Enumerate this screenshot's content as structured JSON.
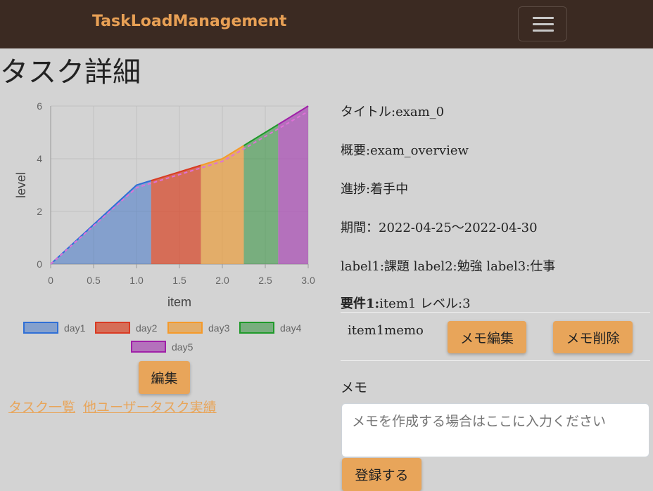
{
  "nav": {
    "brand": "TaskLoadManagement"
  },
  "page": {
    "title": "タスク詳細"
  },
  "task": {
    "title_line": "タイトル:exam_0",
    "overview_line": "概要:exam_overview",
    "progress_line": "進捗:着手中",
    "period_line": "期間：2022-04-25～2022-04-30",
    "labels_line": "label1:課題 label2:勉強 label3:仕事",
    "requirement_heading": "要件1:",
    "requirement_detail": "item1 レベル:3",
    "memo_text": "item1memo",
    "memo_edit_label": "メモ編集",
    "memo_delete_label": "メモ削除"
  },
  "memo": {
    "label": "メモ",
    "placeholder": "メモを作成する場合はここに入力ください",
    "submit_label": "登録する"
  },
  "actions": {
    "edit_label": "編集",
    "task_list_link": "タスク一覧",
    "other_users_link": "他ユーザータスク実績"
  },
  "chart_data": {
    "type": "area",
    "xlabel": "item",
    "ylabel": "level",
    "xlim": [
      0,
      3.0
    ],
    "ylim": [
      0,
      6
    ],
    "x_ticks": [
      "0",
      "0.5",
      "1.0",
      "1.5",
      "2.0",
      "2.5",
      "3.0"
    ],
    "y_ticks": [
      "0",
      "2",
      "4",
      "6"
    ],
    "grid": true,
    "legend_position": "bottom",
    "line": [
      [
        0,
        0
      ],
      [
        1.0,
        3.0
      ],
      [
        2.0,
        4.0
      ],
      [
        3.0,
        6.0
      ]
    ],
    "dashed_line": [
      [
        0,
        0
      ],
      [
        1.0,
        2.9
      ],
      [
        2.0,
        3.9
      ],
      [
        3.0,
        5.8
      ]
    ],
    "series": [
      {
        "name": "day1",
        "x_range": [
          0,
          1.17
        ],
        "fill": "rgba(54,110,200,0.5)",
        "stroke": "#2f6fd6"
      },
      {
        "name": "day2",
        "x_range": [
          1.17,
          1.75
        ],
        "fill": "rgba(215,75,45,0.75)",
        "stroke": "#d93a23"
      },
      {
        "name": "day3",
        "x_range": [
          1.75,
          2.25
        ],
        "fill": "rgba(232,160,70,0.75)",
        "stroke": "#f59a2a"
      },
      {
        "name": "day4",
        "x_range": [
          2.25,
          2.65
        ],
        "fill": "rgba(60,150,70,0.6)",
        "stroke": "#1f9a2a"
      },
      {
        "name": "day5",
        "x_range": [
          2.65,
          3.0
        ],
        "fill": "rgba(170,80,180,0.75)",
        "stroke": "#a020a8"
      }
    ]
  }
}
